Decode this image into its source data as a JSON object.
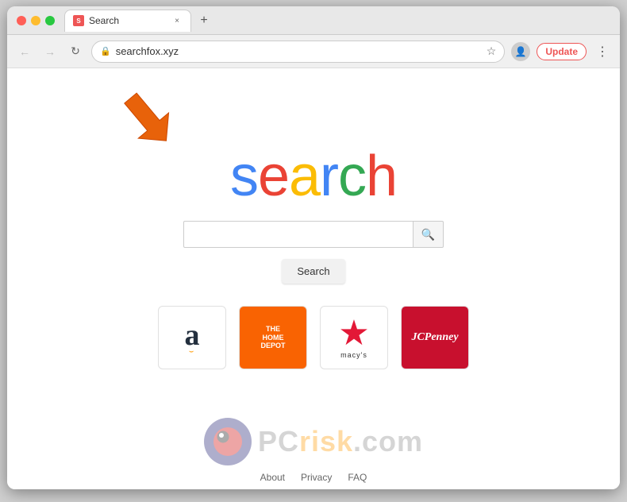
{
  "browser": {
    "tab": {
      "favicon_label": "S",
      "title": "Search",
      "close_label": "×"
    },
    "new_tab_label": "+",
    "toolbar": {
      "back_label": "←",
      "forward_label": "→",
      "reload_label": "↻",
      "address": "searchfox.xyz",
      "star_label": "☆",
      "profile_label": "👤",
      "update_label": "Update",
      "menu_label": "⋮"
    }
  },
  "page": {
    "logo_letters": [
      {
        "char": "s",
        "color_class": "s-blue"
      },
      {
        "char": "e",
        "color_class": "s-red"
      },
      {
        "char": "a",
        "color_class": "s-yellow"
      },
      {
        "char": "r",
        "color_class": "s-blue2"
      },
      {
        "char": "c",
        "color_class": "s-green"
      },
      {
        "char": "h",
        "color_class": "s-red2"
      }
    ],
    "search_placeholder": "",
    "search_button_label": "Search",
    "search_icon": "🔍",
    "quick_links": [
      {
        "id": "amazon",
        "label": "Amazon"
      },
      {
        "id": "homedepot",
        "label": "The Home Depot"
      },
      {
        "id": "macys",
        "label": "Macy's"
      },
      {
        "id": "jcpenney",
        "label": "JCPenney"
      }
    ],
    "footer_links": [
      {
        "label": "About"
      },
      {
        "label": "Privacy"
      },
      {
        "label": "FAQ"
      }
    ]
  }
}
